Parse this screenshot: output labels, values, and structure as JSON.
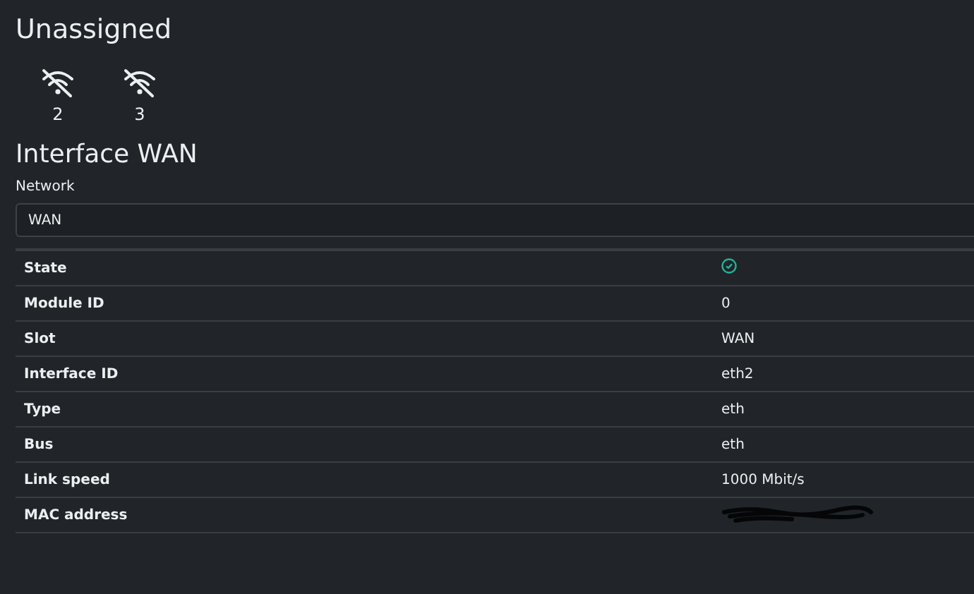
{
  "title": "Unassigned",
  "unassigned": [
    {
      "label": "2",
      "connected": false
    },
    {
      "label": "3",
      "connected": false
    }
  ],
  "interface": {
    "title": "Interface WAN",
    "network_label": "Network",
    "network_value": "WAN"
  },
  "rows": [
    {
      "label": "State",
      "kind": "status",
      "ok": true
    },
    {
      "label": "Module ID",
      "kind": "text",
      "value": "0"
    },
    {
      "label": "Slot",
      "kind": "text",
      "value": "WAN"
    },
    {
      "label": "Interface ID",
      "kind": "text",
      "value": "eth2"
    },
    {
      "label": "Type",
      "kind": "text",
      "value": "eth"
    },
    {
      "label": "Bus",
      "kind": "text",
      "value": "eth"
    },
    {
      "label": "Link speed",
      "kind": "text",
      "value": "1000 Mbit/s"
    },
    {
      "label": "MAC address",
      "kind": "redacted"
    }
  ]
}
